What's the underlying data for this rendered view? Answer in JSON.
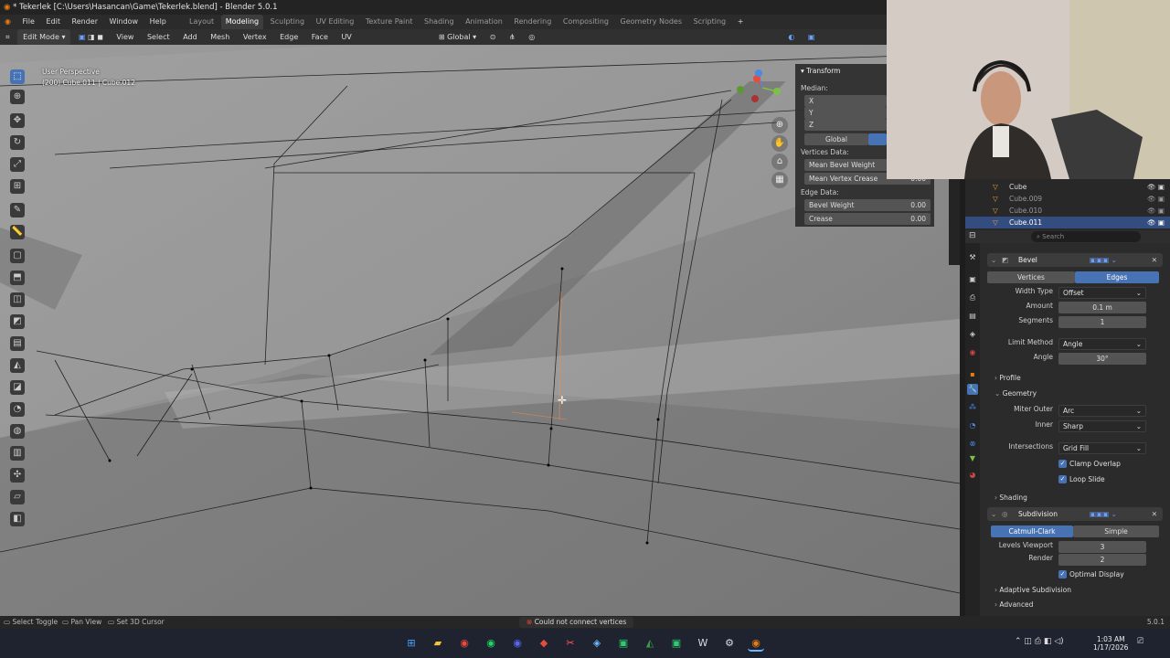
{
  "window": {
    "title": "* Tekerlek [C:\\Users\\Hasancan\\Game\\Tekerlek.blend] - Blender 5.0.1"
  },
  "menu": [
    "File",
    "Edit",
    "Render",
    "Window",
    "Help"
  ],
  "workspaces": [
    "Layout",
    "Modeling",
    "Sculpting",
    "UV Editing",
    "Texture Paint",
    "Shading",
    "Animation",
    "Rendering",
    "Compositing",
    "Geometry Nodes",
    "Scripting"
  ],
  "active_workspace": "Modeling",
  "header": {
    "mode": "Edit Mode",
    "menus": [
      "View",
      "Select",
      "Add",
      "Mesh",
      "Vertex",
      "Edge",
      "Face",
      "UV"
    ],
    "orientation": "Global"
  },
  "viewport": {
    "perspective": "User Perspective",
    "object_info": "(200) Cube.011 | Cube.012"
  },
  "npanel": {
    "title": "Transform",
    "median_label": "Median:",
    "axes": [
      "X",
      "Y",
      "Z"
    ],
    "space_button": "Global",
    "vertices_data_label": "Vertices Data:",
    "mean_bevel_weight": "Mean Bevel Weight",
    "mean_vertex_crease": "Mean Vertex Crease",
    "mean_vertex_crease_value": "0.00",
    "edge_data_label": "Edge Data:",
    "bevel_weight_label": "Bevel Weight",
    "bevel_weight_value": "0.00",
    "crease_label": "Crease",
    "crease_value": "0.00"
  },
  "outliner": {
    "items": [
      {
        "name": "Cube"
      },
      {
        "name": "Cube.009"
      },
      {
        "name": "Cube.010"
      },
      {
        "name": "Cube.011",
        "selected": true
      }
    ],
    "search_placeholder": "Search"
  },
  "properties": {
    "bevel": {
      "name": "Bevel",
      "affect": [
        "Vertices",
        "Edges"
      ],
      "affect_active": "Edges",
      "width_type_label": "Width Type",
      "width_type": "Offset",
      "amount_label": "Amount",
      "amount": "0.1 m",
      "segments_label": "Segments",
      "segments": "1",
      "limit_method_label": "Limit Method",
      "limit_method": "Angle",
      "angle_label": "Angle",
      "angle": "30°",
      "profile_label": "Profile",
      "geometry_label": "Geometry",
      "miter_outer_label": "Miter Outer",
      "miter_outer": "Arc",
      "inner_label": "Inner",
      "inner": "Sharp",
      "intersections_label": "Intersections",
      "intersections": "Grid Fill",
      "clamp_overlap": "Clamp Overlap",
      "loop_slide": "Loop Slide",
      "shading_label": "Shading"
    },
    "subdivision": {
      "name": "Subdivision",
      "types": [
        "Catmull-Clark",
        "Simple"
      ],
      "type_active": "Catmull-Clark",
      "levels_viewport_label": "Levels Viewport",
      "levels_viewport": "3",
      "render_label": "Render",
      "render": "2",
      "optimal_display": "Optimal Display",
      "adaptive_label": "Adaptive Subdivision",
      "advanced_label": "Advanced"
    }
  },
  "statusbar": {
    "select_toggle": "Select Toggle",
    "pan_view": "Pan View",
    "set_cursor": "Set 3D Cursor",
    "message": "Could not connect vertices",
    "version": "5.0.1"
  },
  "taskbar": {
    "time": "1:03 AM",
    "date": "1/17/2026"
  },
  "colors": {
    "accent": "#4772b3",
    "viewport_bg": "#8e8e8e",
    "error": "#e84b3c"
  }
}
